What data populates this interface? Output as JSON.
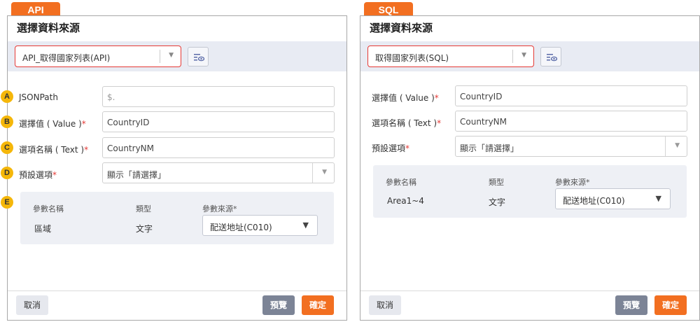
{
  "left": {
    "badge": "API",
    "title": "選擇資料來源",
    "source_select": "API_取得國家列表(API)",
    "markers": [
      "A",
      "B",
      "C",
      "D",
      "E"
    ],
    "fields": {
      "jsonpath": {
        "label": "JSONPath",
        "placeholder": "$."
      },
      "value": {
        "label": "選擇值 ( Value )",
        "required": "*",
        "value": "CountryID"
      },
      "text": {
        "label": "選項名稱 ( Text )",
        "required": "*",
        "value": "CountryNM"
      },
      "default": {
        "label": "預設選項",
        "required": "*",
        "value": "顯示「請選擇」"
      }
    },
    "params": {
      "headers": {
        "name": "參數名稱",
        "type": "類型",
        "source": "參數來源",
        "required": "*"
      },
      "row": {
        "name": "區域",
        "type": "文字",
        "source": "配送地址(C010)"
      }
    },
    "buttons": {
      "cancel": "取消",
      "preview": "預覽",
      "confirm": "確定"
    }
  },
  "right": {
    "badge": "SQL",
    "title": "選擇資料來源",
    "source_select": "取得國家列表(SQL)",
    "fields": {
      "value": {
        "label": "選擇值 ( Value )",
        "required": "*",
        "value": "CountryID"
      },
      "text": {
        "label": "選項名稱 ( Text )",
        "required": "*",
        "value": "CountryNM"
      },
      "default": {
        "label": "預設選項",
        "required": "*",
        "value": "顯示「請選擇」"
      }
    },
    "params": {
      "headers": {
        "name": "參數名稱",
        "type": "類型",
        "source": "參數來源",
        "required": "*"
      },
      "row": {
        "name": "Area1~4",
        "type": "文字",
        "source": "配送地址(C010)"
      }
    },
    "buttons": {
      "cancel": "取消",
      "preview": "預覽",
      "confirm": "確定"
    }
  },
  "colors": {
    "accent": "#f26f21",
    "required": "#e53935",
    "marker": "#f5b70a",
    "topbar": "#e8ebf3"
  }
}
